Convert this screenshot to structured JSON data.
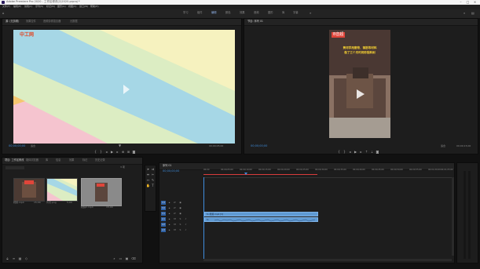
{
  "window": {
    "title": "Adobe Premiere Pro 2020 - 工作区修改(2)2020.prproj *"
  },
  "menu": [
    "文件(F)",
    "编辑(E)",
    "剪辑(C)",
    "序列(S)",
    "标记(M)",
    "图形(G)",
    "视图(V)",
    "窗口(W)",
    "帮助(H)"
  ],
  "workspaces": [
    "学习",
    "组件",
    "编辑",
    "颜色",
    "效果",
    "音频",
    "图形",
    "库",
    "字幕"
  ],
  "source_panel": {
    "tabs": [
      "源: (无剪辑)",
      "效果控件",
      "音频剪辑混合器",
      "元数据"
    ],
    "timecode": "00;00;00;00",
    "fit": "适合",
    "end_time": "00;00;05;00",
    "watermark_text": "中工网"
  },
  "program_panel": {
    "tabs": [
      "节目: 序列 01"
    ],
    "timecode": "00;00;00;00",
    "fit": "适合",
    "end_time": "00;00;15;00",
    "brand": "B音超",
    "headline_line1": "黄河学用废物、钢筋等材料",
    "headline_line2": "做了三个月时间彩铝料刹"
  },
  "project_panel": {
    "tabs": [
      "项目: 工作区修改",
      "媒体浏览器",
      "库",
      "信息",
      "效果",
      "标记",
      "历史记录"
    ],
    "item_count": "3 项",
    "items": [
      {
        "name": "视频.mp4",
        "duration": "15;00"
      },
      {
        "name": "背景.png",
        "duration": "5;00"
      },
      {
        "name": "视频2.mp4",
        "duration": "15;00"
      }
    ]
  },
  "timeline": {
    "tab": "序列 01",
    "timecode": "00;00;00;00",
    "ruler": [
      "00;00",
      "00;00;05;00",
      "00;00;10;00",
      "00;00;15;00",
      "00;00;20;00",
      "00;00;25;00",
      "00;00;30;00",
      "00;00;35;00",
      "00;00;40;00",
      "00;00;45;00",
      "00;00;50;00",
      "00;00;55;00",
      "00;01;00;00",
      "00;01;05;00"
    ],
    "video_tracks": [
      "V3",
      "V2",
      "V1"
    ],
    "audio_tracks": [
      "A1",
      "A2",
      "A3"
    ],
    "video_clip_label": "fx 视频.mp4 [V]",
    "audio_clip_label": "fx"
  },
  "colors": {
    "accent_blue": "#3f8ede",
    "clip_blue": "#5f9ad3",
    "pastel_green": "#dcedc3",
    "pastel_blue": "#a6d7e6",
    "pastel_yellow": "#f6f2bf",
    "pastel_pink": "#f5c4cf"
  }
}
